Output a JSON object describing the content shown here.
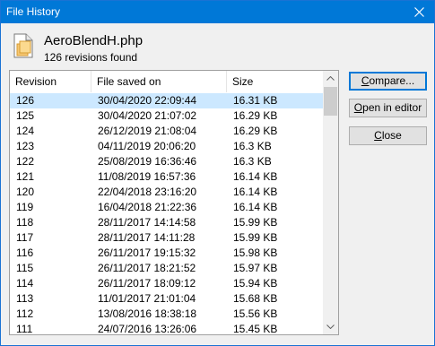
{
  "window": {
    "title": "File History"
  },
  "header": {
    "filename": "AeroBlendH.php",
    "revisions_found": "126 revisions found"
  },
  "list": {
    "columns": [
      "Revision",
      "File saved on",
      "Size"
    ],
    "selected_index": 0,
    "rows": [
      [
        "126",
        "30/04/2020 22:09:44",
        "16.31 KB"
      ],
      [
        "125",
        "30/04/2020 21:07:02",
        "16.29 KB"
      ],
      [
        "124",
        "26/12/2019 21:08:04",
        "16.29 KB"
      ],
      [
        "123",
        "04/11/2019 20:06:20",
        "16.3 KB"
      ],
      [
        "122",
        "25/08/2019 16:36:46",
        "16.3 KB"
      ],
      [
        "121",
        "11/08/2019 16:57:36",
        "16.14 KB"
      ],
      [
        "120",
        "22/04/2018 23:16:20",
        "16.14 KB"
      ],
      [
        "119",
        "16/04/2018 21:22:36",
        "16.14 KB"
      ],
      [
        "118",
        "28/11/2017 14:14:58",
        "15.99 KB"
      ],
      [
        "117",
        "28/11/2017 14:11:28",
        "15.99 KB"
      ],
      [
        "116",
        "26/11/2017 19:15:32",
        "15.98 KB"
      ],
      [
        "115",
        "26/11/2017 18:21:52",
        "15.97 KB"
      ],
      [
        "114",
        "26/11/2017 18:09:12",
        "15.94 KB"
      ],
      [
        "113",
        "11/01/2017 21:01:04",
        "15.68 KB"
      ],
      [
        "112",
        "13/08/2016 18:38:18",
        "15.56 KB"
      ],
      [
        "111",
        "24/07/2016 13:26:06",
        "15.45 KB"
      ]
    ]
  },
  "buttons": {
    "compare": {
      "pre": "",
      "key": "C",
      "post": "ompare..."
    },
    "open_in_editor": {
      "pre": "",
      "key": "O",
      "post": "pen in editor"
    },
    "close": {
      "pre": "",
      "key": "C",
      "post": "lose"
    }
  },
  "colors": {
    "titlebar": "#0078d7",
    "selection": "#cce8ff",
    "default_button_border": "#0078d7"
  },
  "icons": {
    "close": "close-icon",
    "file": "php-file-icon",
    "scroll_up": "chevron-up-icon",
    "scroll_down": "chevron-down-icon"
  }
}
